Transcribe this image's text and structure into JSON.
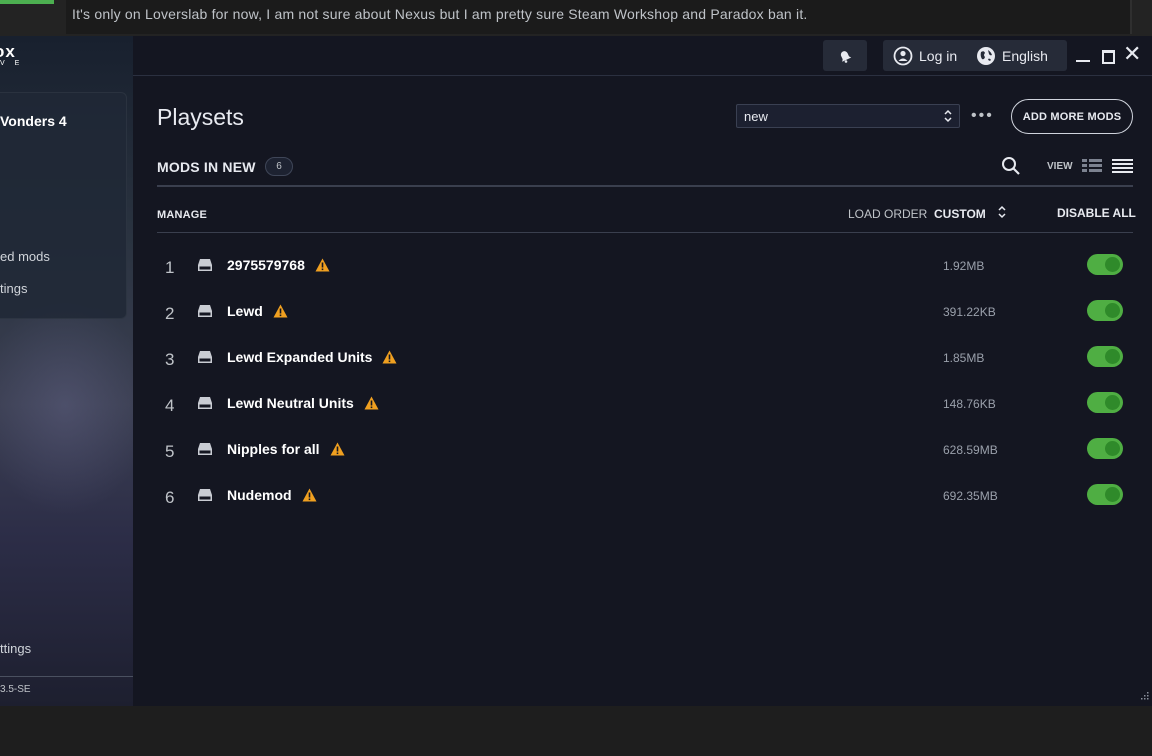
{
  "chat": {
    "message": "It's only on Loverslab for now, I am not sure about Nexus but I am pretty sure Steam Workshop and Paradox ban it."
  },
  "sidebar": {
    "logo": "ox",
    "logo_sub": "V E",
    "game_title": "Vonders 4",
    "link_installed": "ed mods",
    "link_settings": "tings",
    "settings": "ttings",
    "version": "3.5-SE"
  },
  "topbar": {
    "login_label": "Log in",
    "language_label": "English",
    "close_glyph": "✕"
  },
  "playsets": {
    "title": "Playsets",
    "selected": "new",
    "more_glyph": "•••",
    "add_more_label": "ADD MORE MODS"
  },
  "mods_header": {
    "title": "MODS IN NEW",
    "count": "6",
    "view_label": "VIEW"
  },
  "table_header": {
    "manage": "MANAGE",
    "load_order": "LOAD ORDER",
    "custom": "CUSTOM",
    "disable_all": "DISABLE ALL"
  },
  "mods": [
    {
      "index": "1",
      "name": "2975579768",
      "size": "1.92MB",
      "enabled": true,
      "warning": true
    },
    {
      "index": "2",
      "name": "Lewd",
      "size": "391.22KB",
      "enabled": true,
      "warning": true
    },
    {
      "index": "3",
      "name": "Lewd Expanded Units",
      "size": "1.85MB",
      "enabled": true,
      "warning": true
    },
    {
      "index": "4",
      "name": "Lewd Neutral Units",
      "size": "148.76KB",
      "enabled": true,
      "warning": true
    },
    {
      "index": "5",
      "name": "Nipples for all",
      "size": "628.59MB",
      "enabled": true,
      "warning": true
    },
    {
      "index": "6",
      "name": "Nudemod",
      "size": "692.35MB",
      "enabled": true,
      "warning": true
    }
  ],
  "colors": {
    "toggle_on": "#4fae43",
    "warning": "#f0a020",
    "background": "#141621"
  }
}
